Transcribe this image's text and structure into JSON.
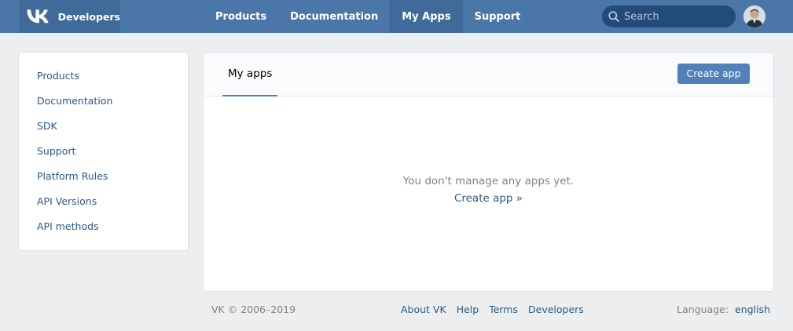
{
  "colors": {
    "header_bg": "#4a76a8",
    "header_active": "#3f6a99",
    "link": "#2a5885",
    "button": "#5181b8",
    "page_bg": "#edeef0"
  },
  "header": {
    "brand_text": "Developers",
    "logo_icon": "vk-logo-icon",
    "nav": [
      {
        "label": "Products",
        "active": false
      },
      {
        "label": "Documentation",
        "active": false
      },
      {
        "label": "My Apps",
        "active": true
      },
      {
        "label": "Support",
        "active": false
      }
    ],
    "search": {
      "placeholder": "Search",
      "value": ""
    },
    "avatar_icon": "user-avatar"
  },
  "sidebar": {
    "items": [
      {
        "label": "Products"
      },
      {
        "label": "Documentation"
      },
      {
        "label": "SDK"
      },
      {
        "label": "Support"
      },
      {
        "label": "Platform Rules"
      },
      {
        "label": "API Versions"
      },
      {
        "label": "API methods"
      }
    ]
  },
  "main": {
    "tab_label": "My apps",
    "create_button": "Create app",
    "empty_message": "You don't manage any apps yet.",
    "empty_link": "Create app »"
  },
  "footer": {
    "copyright": "VK © 2006–2019",
    "links": [
      "About VK",
      "Help",
      "Terms",
      "Developers"
    ],
    "language_label": "Language:",
    "language_value": "english"
  }
}
